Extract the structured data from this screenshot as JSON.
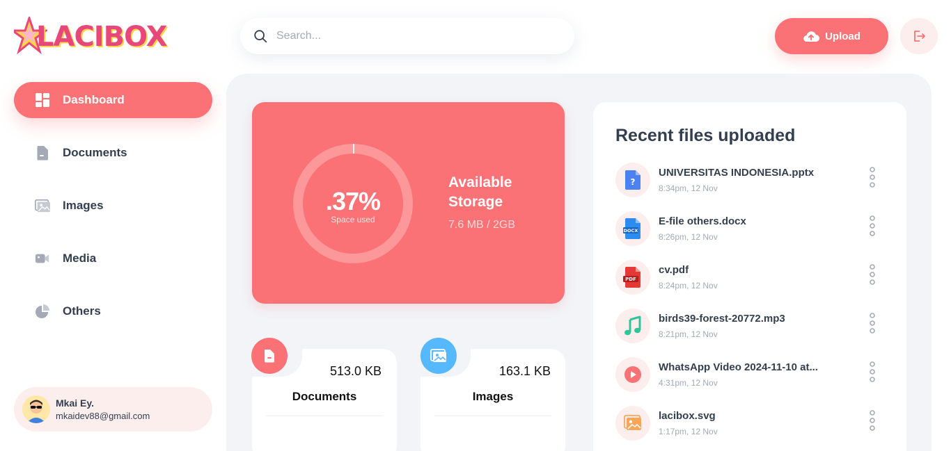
{
  "brand": {
    "logo_text": "LACIBOX",
    "accent": "#fa7275",
    "bg_soft": "#fdeeee",
    "panel_bg": "#f2f4f8"
  },
  "search": {
    "placeholder": "Search..."
  },
  "header": {
    "upload_label": "Upload"
  },
  "sidebar": {
    "items": [
      {
        "label": "Dashboard",
        "icon": "dashboard-icon",
        "active": true
      },
      {
        "label": "Documents",
        "icon": "documents-icon",
        "active": false
      },
      {
        "label": "Images",
        "icon": "images-icon",
        "active": false
      },
      {
        "label": "Media",
        "icon": "media-icon",
        "active": false
      },
      {
        "label": "Others",
        "icon": "others-icon",
        "active": false
      }
    ]
  },
  "user": {
    "name": "Mkai Ey.",
    "email": "mkaidev88@gmail.com"
  },
  "storage": {
    "percent_label": ".37%",
    "percent_value": 0.37,
    "percent_caption": "Space used",
    "title": "Available Storage",
    "size": "7.6 MB / 2GB"
  },
  "types": [
    {
      "name": "Documents",
      "size": "513.0 KB",
      "icon": "documents-icon",
      "color": "#fa7275"
    },
    {
      "name": "Images",
      "size": "163.1 KB",
      "icon": "images-icon",
      "color": "#56b8ff"
    }
  ],
  "recent": {
    "title": "Recent files uploaded",
    "files": [
      {
        "name": "UNIVERSITAS INDONESIA.pptx",
        "date": "8:34pm, 12 Nov",
        "icon": "pptx-file-icon"
      },
      {
        "name": "E-file others.docx",
        "date": "8:26pm, 12 Nov",
        "icon": "docx-file-icon"
      },
      {
        "name": "cv.pdf",
        "date": "8:24pm, 12 Nov",
        "icon": "pdf-file-icon"
      },
      {
        "name": "birds39-forest-20772.mp3",
        "date": "8:21pm, 12 Nov",
        "icon": "audio-file-icon"
      },
      {
        "name": "WhatsApp Video 2024-11-10 at...",
        "date": "4:31pm, 12 Nov",
        "icon": "video-file-icon"
      },
      {
        "name": "lacibox.svg",
        "date": "1:17pm, 12 Nov",
        "icon": "image-file-icon"
      }
    ]
  }
}
